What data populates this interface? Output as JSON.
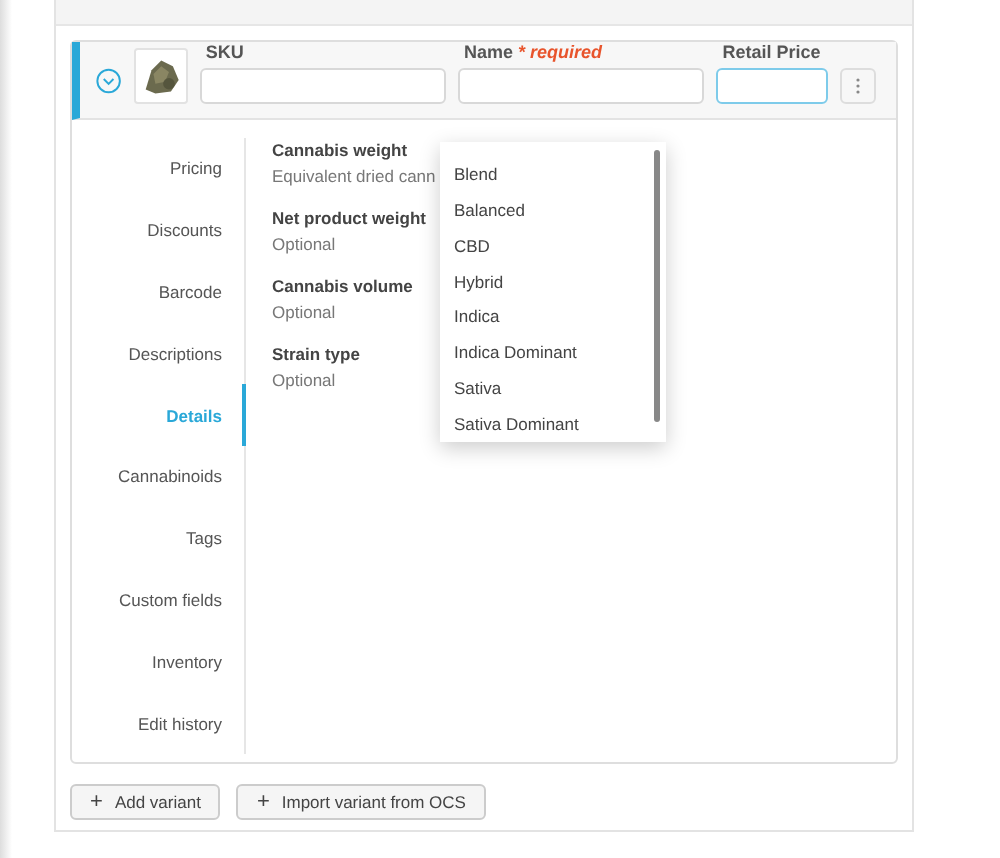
{
  "variant": {
    "expanded": true,
    "fields": [
      {
        "label": "SKU",
        "focused": false
      },
      {
        "label": "Name",
        "required_note": "* required",
        "focused": false
      },
      {
        "label": "Retail Price",
        "focused": true
      }
    ]
  },
  "nav": [
    {
      "label": "Pricing",
      "selected": false
    },
    {
      "label": "Discounts",
      "selected": false
    },
    {
      "label": "Barcode",
      "selected": false
    },
    {
      "label": "Descriptions",
      "selected": false
    },
    {
      "label": "Details",
      "selected": true
    },
    {
      "label": "Cannabinoids",
      "selected": false
    },
    {
      "label": "Tags",
      "selected": false
    },
    {
      "label": "Custom fields",
      "selected": false
    },
    {
      "label": "Inventory",
      "selected": false
    },
    {
      "label": "Edit history",
      "selected": false
    }
  ],
  "details": [
    {
      "label": "Cannabis weight",
      "hint": "Equivalent dried cann"
    },
    {
      "label": "Net product weight",
      "hint": "Optional"
    },
    {
      "label": "Cannabis volume",
      "hint": "Optional"
    },
    {
      "label": "Strain type",
      "hint": "Optional"
    }
  ],
  "dropdown": {
    "options": [
      "Blend",
      "Balanced",
      "CBD",
      "Hybrid",
      "Indica",
      "Indica Dominant",
      "Sativa",
      "Sativa Dominant"
    ]
  },
  "buttons": [
    {
      "icon": "+",
      "label": "Add variant"
    },
    {
      "icon": "+",
      "label": "Import variant from OCS"
    }
  ]
}
